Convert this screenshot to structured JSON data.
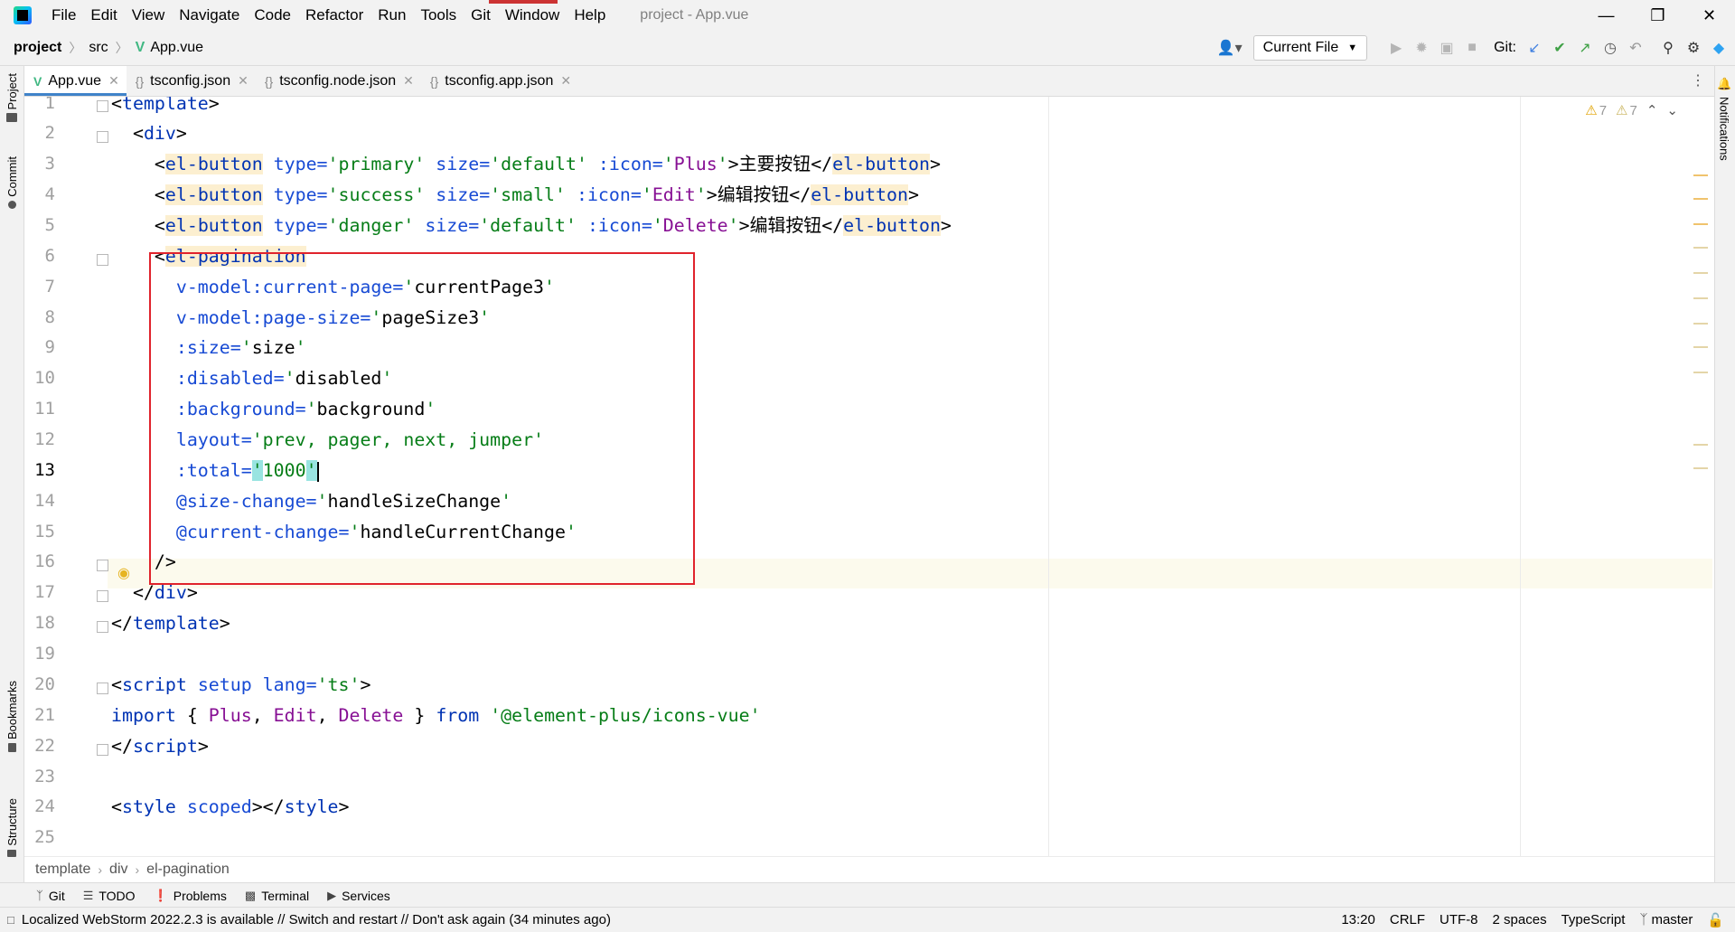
{
  "window": {
    "title": "project - App.vue",
    "menu": [
      "File",
      "Edit",
      "View",
      "Navigate",
      "Code",
      "Refactor",
      "Run",
      "Tools",
      "Git",
      "Window",
      "Help"
    ],
    "minimize": "—",
    "restore": "❐",
    "close": "✕"
  },
  "navbar": {
    "breadcrumbs": [
      "project",
      "src",
      "App.vue"
    ],
    "run_config": "Current File",
    "git_label": "Git:"
  },
  "left_tools": [
    "Project",
    "Commit",
    "Bookmarks",
    "Structure"
  ],
  "right_tools": [
    "Notifications"
  ],
  "tabs": [
    {
      "label": "App.vue",
      "icon": "vue-icon",
      "active": true
    },
    {
      "label": "tsconfig.json",
      "icon": "json-icon",
      "active": false
    },
    {
      "label": "tsconfig.node.json",
      "icon": "json-icon",
      "active": false
    },
    {
      "label": "tsconfig.app.json",
      "icon": "json-icon",
      "active": false
    }
  ],
  "editor": {
    "line_numbers": [
      "1",
      "2",
      "3",
      "4",
      "5",
      "6",
      "7",
      "8",
      "9",
      "10",
      "11",
      "12",
      "13",
      "14",
      "15",
      "16",
      "17",
      "18",
      "19",
      "20",
      "21",
      "22",
      "23",
      "24",
      "25"
    ],
    "current_line": "13",
    "inspections": {
      "warnings": "7",
      "weak_warnings": "7"
    },
    "code": {
      "l1": [
        "<",
        "template",
        ">"
      ],
      "l2": [
        "  <",
        "div",
        ">"
      ],
      "l3": [
        "    <",
        "el-button",
        " type=",
        "'primary'",
        " size=",
        "'default'",
        " :icon=",
        "'",
        "Plus",
        "'",
        ">",
        "主要按钮",
        "</",
        "el-button",
        ">"
      ],
      "l4": [
        "    <",
        "el-button",
        " type=",
        "'success'",
        " size=",
        "'small'",
        " :icon=",
        "'",
        "Edit",
        "'",
        ">",
        "编辑按钮",
        "</",
        "el-button",
        ">"
      ],
      "l5": [
        "    <",
        "el-button",
        " type=",
        "'danger'",
        " size=",
        "'default'",
        " :icon=",
        "'",
        "Delete",
        "'",
        ">",
        "编辑按钮",
        "</",
        "el-button",
        ">"
      ],
      "l6": [
        "    <",
        "el-pagination"
      ],
      "l7": [
        "      v-model:current-page=",
        "'",
        "currentPage3",
        "'"
      ],
      "l8": [
        "      v-model:page-size=",
        "'",
        "pageSize3",
        "'"
      ],
      "l9": [
        "      :size=",
        "'",
        "size",
        "'"
      ],
      "l10": [
        "      :disabled=",
        "'",
        "disabled",
        "'"
      ],
      "l11": [
        "      :background=",
        "'",
        "background",
        "'"
      ],
      "l12": [
        "      layout=",
        "'prev, pager, next, jumper'"
      ],
      "l13": [
        "      :total=",
        "'",
        "1000",
        "'"
      ],
      "l14": [
        "      @size-change=",
        "'",
        "handleSizeChange",
        "'"
      ],
      "l15": [
        "      @current-change=",
        "'",
        "handleCurrentChange",
        "'"
      ],
      "l16": [
        "    />"
      ],
      "l17": [
        "  </",
        "div",
        ">"
      ],
      "l18": [
        "</",
        "template",
        ">"
      ],
      "l20": [
        "<",
        "script",
        " setup",
        " lang=",
        "'ts'",
        ">"
      ],
      "l21": [
        "import",
        " { ",
        "Plus",
        ", ",
        "Edit",
        ", ",
        "Delete",
        " } ",
        "from",
        " ",
        "'@element-plus/icons-vue'"
      ],
      "l22": [
        "</",
        "script",
        ">"
      ],
      "l24": [
        "<",
        "style",
        " scoped",
        "></",
        "style",
        ">"
      ]
    },
    "breadcrumbs": [
      "template",
      "div",
      "el-pagination"
    ]
  },
  "tool_windows": [
    {
      "label": "Git",
      "icon": "git-branch-icon"
    },
    {
      "label": "TODO",
      "icon": "list-icon"
    },
    {
      "label": "Problems",
      "icon": "problems-icon"
    },
    {
      "label": "Terminal",
      "icon": "terminal-icon"
    },
    {
      "label": "Services",
      "icon": "services-icon"
    }
  ],
  "status": {
    "message": "Localized WebStorm 2022.2.3 is available // Switch and restart // Don't ask again (34 minutes ago)",
    "position": "13:20",
    "line_sep": "CRLF",
    "encoding": "UTF-8",
    "indent": "2 spaces",
    "language": "TypeScript",
    "branch": "master"
  },
  "colors": {
    "tag": "#0033b3",
    "attribute": "#174ad4",
    "string": "#067d17",
    "identifier": "#871094",
    "highlight_box": "#e0232c"
  }
}
